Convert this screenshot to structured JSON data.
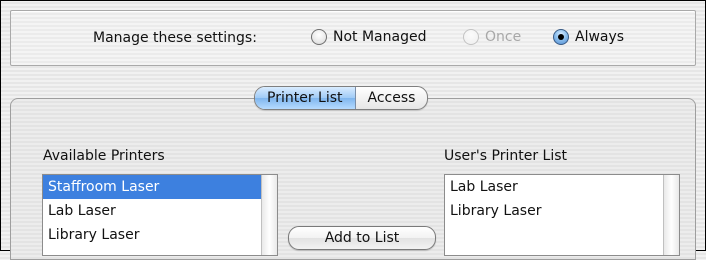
{
  "manage": {
    "label": "Manage these settings:",
    "options": [
      {
        "label": "Not Managed",
        "state": "unselected"
      },
      {
        "label": "Once",
        "state": "disabled"
      },
      {
        "label": "Always",
        "state": "selected"
      }
    ]
  },
  "tabs": [
    {
      "label": "Printer List",
      "active": true
    },
    {
      "label": "Access",
      "active": false
    }
  ],
  "available": {
    "label": "Available Printers",
    "items": [
      "Staffroom Laser",
      "Lab Laser",
      "Library Laser"
    ],
    "selected_index": 0
  },
  "user_list": {
    "label": "User's Printer List",
    "items": [
      "Lab Laser",
      "Library Laser"
    ]
  },
  "add_button_label": "Add to List",
  "colors": {
    "selection": "#3d80df",
    "accent_blue": "#7fb6ee"
  }
}
